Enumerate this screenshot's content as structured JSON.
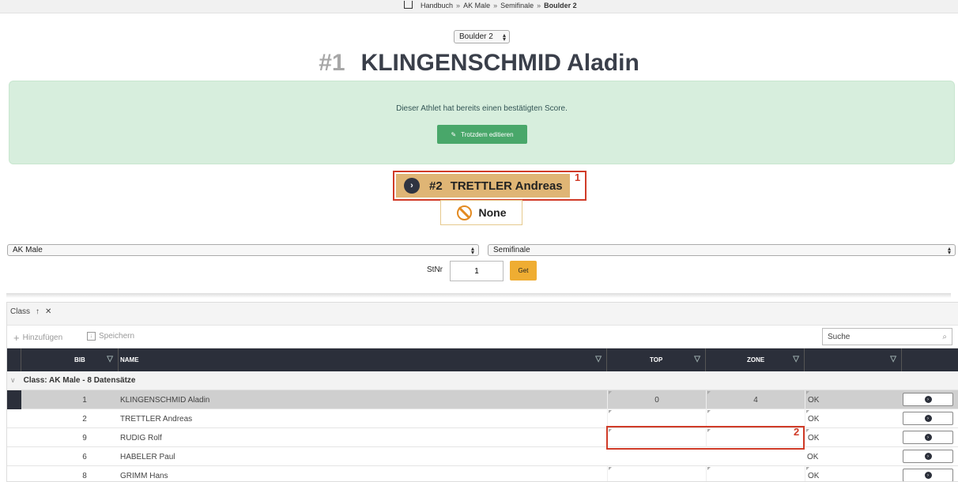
{
  "breadcrumb": {
    "items": [
      "Handbuch",
      "AK Male",
      "Semifinale"
    ],
    "current": "Boulder 2",
    "separator": "»"
  },
  "boulder_select": {
    "value": "Boulder 2"
  },
  "athlete": {
    "number": "#1",
    "name": "KLINGENSCHMID Aladin"
  },
  "alert": {
    "message": "Dieser Athlet hat bereits einen bestätigten Score.",
    "edit_button": "Trotzdem editieren"
  },
  "next_athlete": {
    "number": "#2",
    "name": "TRETTLER Andreas"
  },
  "result_status": "None",
  "annotations": {
    "marker1": "1",
    "marker2": "2"
  },
  "filters": {
    "class_select": "AK Male",
    "round_select": "Semifinale",
    "stnr_label": "StNr",
    "stnr_value": "1",
    "get_button": "Get"
  },
  "grid": {
    "group_chip": "Class",
    "add_label": "Hinzufügen",
    "save_label": "Speichern",
    "search_placeholder": "Suche",
    "columns": {
      "bib": "BIB",
      "name": "NAME",
      "top": "TOP",
      "zone": "ZONE"
    },
    "group_label": "Class: AK Male - 8 Datensätze",
    "rows": [
      {
        "bib": "1",
        "name": "KLINGENSCHMID Aladin",
        "top": "0",
        "zone": "4",
        "status": "OK"
      },
      {
        "bib": "2",
        "name": "TRETTLER Andreas",
        "top": "",
        "zone": "",
        "status": "OK"
      },
      {
        "bib": "9",
        "name": "RUDIG Rolf",
        "top": "",
        "zone": "",
        "status": "OK"
      },
      {
        "bib": "6",
        "name": "HABELER Paul",
        "top": "",
        "zone": "",
        "status": "OK"
      },
      {
        "bib": "8",
        "name": "GRIMM Hans",
        "top": "",
        "zone": "",
        "status": "OK"
      }
    ]
  },
  "colors": {
    "header_dark": "#2b2f3a",
    "success_bg": "#d7eedd",
    "success_button": "#49a76a",
    "next_bg": "#dfb575",
    "get_button": "#efad32",
    "annotation_red": "#d03b28"
  }
}
